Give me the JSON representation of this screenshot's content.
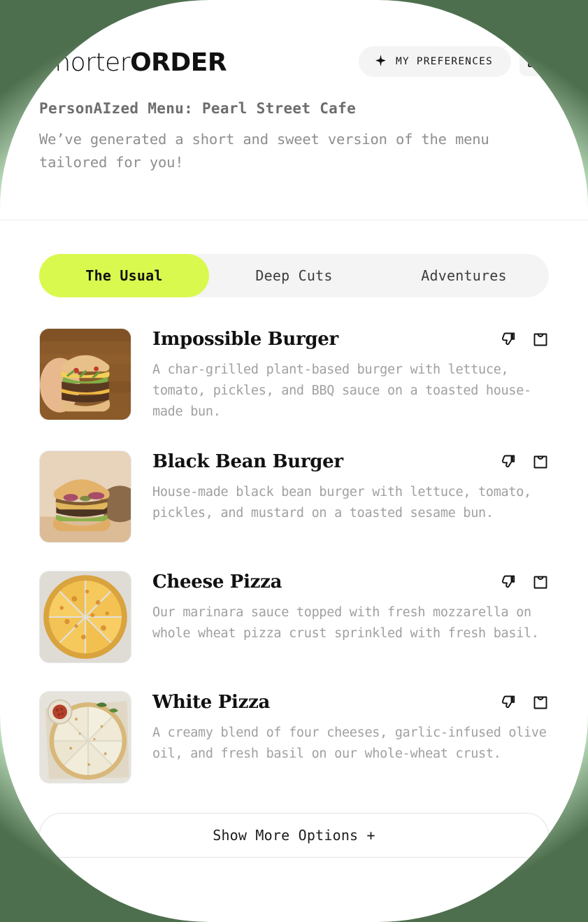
{
  "brand": {
    "name_light": "Shorter",
    "name_bold": "ORDER"
  },
  "header": {
    "preferences_label": "MY PREFERENCES",
    "preferences_icon": "sparkle-icon",
    "bag_icon": "shopping-bag-icon"
  },
  "intro": {
    "title": "PersonAIzed Menu: Pearl Street Cafe",
    "subtitle": "We’ve generated a short and sweet version of the menu tailored for you!"
  },
  "tabs": [
    {
      "label": "The Usual",
      "active": true
    },
    {
      "label": "Deep Cuts",
      "active": false
    },
    {
      "label": "Adventures",
      "active": false
    }
  ],
  "menu_items": [
    {
      "title": "Impossible Burger",
      "description": "A char-grilled plant-based burger with lettuce, tomato, pickles, and BBQ sauce on a toasted house-made bun.",
      "image": "hand-holding-cheeseburger-on-wood-board",
      "dislike_icon": "thumbs-down-icon",
      "add_icon": "shopping-bag-icon"
    },
    {
      "title": "Black Bean Burger",
      "description": "House-made black bean burger with lettuce, tomato, pickles, and mustard on a toasted sesame bun.",
      "image": "black-bean-burger-with-red-onion",
      "dislike_icon": "thumbs-down-icon",
      "add_icon": "shopping-bag-icon"
    },
    {
      "title": "Cheese Pizza",
      "description": "Our marinara sauce topped with fresh mozzarella on whole wheat pizza crust sprinkled with fresh basil.",
      "image": "sliced-cheese-pizza-top-down",
      "dislike_icon": "thumbs-down-icon",
      "add_icon": "shopping-bag-icon"
    },
    {
      "title": "White Pizza",
      "description": "A creamy blend of four cheeses, garlic-infused olive oil, and fresh basil on our whole-wheat crust.",
      "image": "sliced-white-pizza-with-chili-flake-bowl",
      "dislike_icon": "thumbs-down-icon",
      "add_icon": "shopping-bag-icon"
    }
  ],
  "footer": {
    "show_more_label": "Show More Options +"
  },
  "colors": {
    "accent_lime": "#d9f94e",
    "backdrop_green": "#4e6f4e",
    "surface": "#ffffff",
    "muted_text": "#a0a0a0"
  }
}
